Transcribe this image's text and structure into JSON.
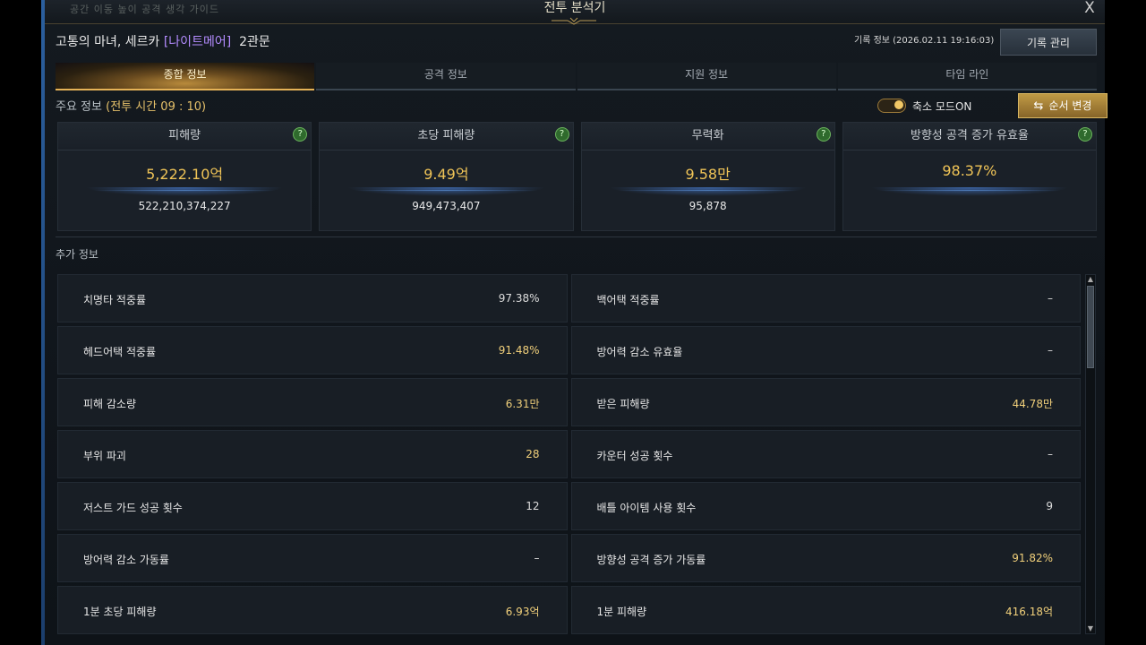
{
  "window": {
    "title": "전투 분석기",
    "close_label": "X",
    "ghost_text": "공간 이동   높이 공격   생각 가이드"
  },
  "header": {
    "character": "고통의 마녀, 세르카",
    "class_tag": "[나이트메어]",
    "stage": "2관문",
    "record_info": "기록 정보 (2026.02.11 19:16:03)",
    "manage_button": "기록 관리"
  },
  "tabs": [
    {
      "label": "종합 정보",
      "active": true
    },
    {
      "label": "공격 정보",
      "active": false
    },
    {
      "label": "지원 정보",
      "active": false
    },
    {
      "label": "타임 라인",
      "active": false
    }
  ],
  "main_info": {
    "label": "주요 정보",
    "time_label": "(전투 시간 09 : 10)"
  },
  "toggle": {
    "label": "축소 모드ON",
    "on": true
  },
  "order_button": {
    "label": "순서 변경",
    "icon": "swap-arrows-icon"
  },
  "cards": [
    {
      "label": "피해량",
      "value": "5,222.10억",
      "raw": "522,210,374,227"
    },
    {
      "label": "초당 피해량",
      "value": "9.49억",
      "raw": "949,473,407"
    },
    {
      "label": "무력화",
      "value": "9.58만",
      "raw": "95,878"
    },
    {
      "label": "방향성 공격 증가 유효율",
      "value": "98.37%",
      "raw": ""
    }
  ],
  "help_icon_glyph": "?",
  "extra": {
    "title": "추가 정보",
    "rows": [
      {
        "name": "치명타 적중률",
        "value": "97.38%",
        "gold": false
      },
      {
        "name": "백어택 적중률",
        "value": "–",
        "gold": false
      },
      {
        "name": "헤드어택 적중률",
        "value": "91.48%",
        "gold": true
      },
      {
        "name": "방어력 감소 유효율",
        "value": "–",
        "gold": false
      },
      {
        "name": "피해 감소량",
        "value": "6.31만",
        "gold": true
      },
      {
        "name": "받은 피해량",
        "value": "44.78만",
        "gold": true
      },
      {
        "name": "부위 파괴",
        "value": "28",
        "gold": true
      },
      {
        "name": "카운터 성공 횟수",
        "value": "–",
        "gold": false
      },
      {
        "name": "저스트 가드 성공 횟수",
        "value": "12",
        "gold": false
      },
      {
        "name": "배틀 아이템 사용 횟수",
        "value": "9",
        "gold": false
      },
      {
        "name": "방어력 감소 가동률",
        "value": "–",
        "gold": false
      },
      {
        "name": "방향성 공격 증가 가동률",
        "value": "91.82%",
        "gold": true
      },
      {
        "name": "1분 초당 피해량",
        "value": "6.93억",
        "gold": true
      },
      {
        "name": "1분 피해량",
        "value": "416.18억",
        "gold": true
      }
    ]
  },
  "scrollbar": {
    "up": "▲",
    "down": "▼"
  }
}
